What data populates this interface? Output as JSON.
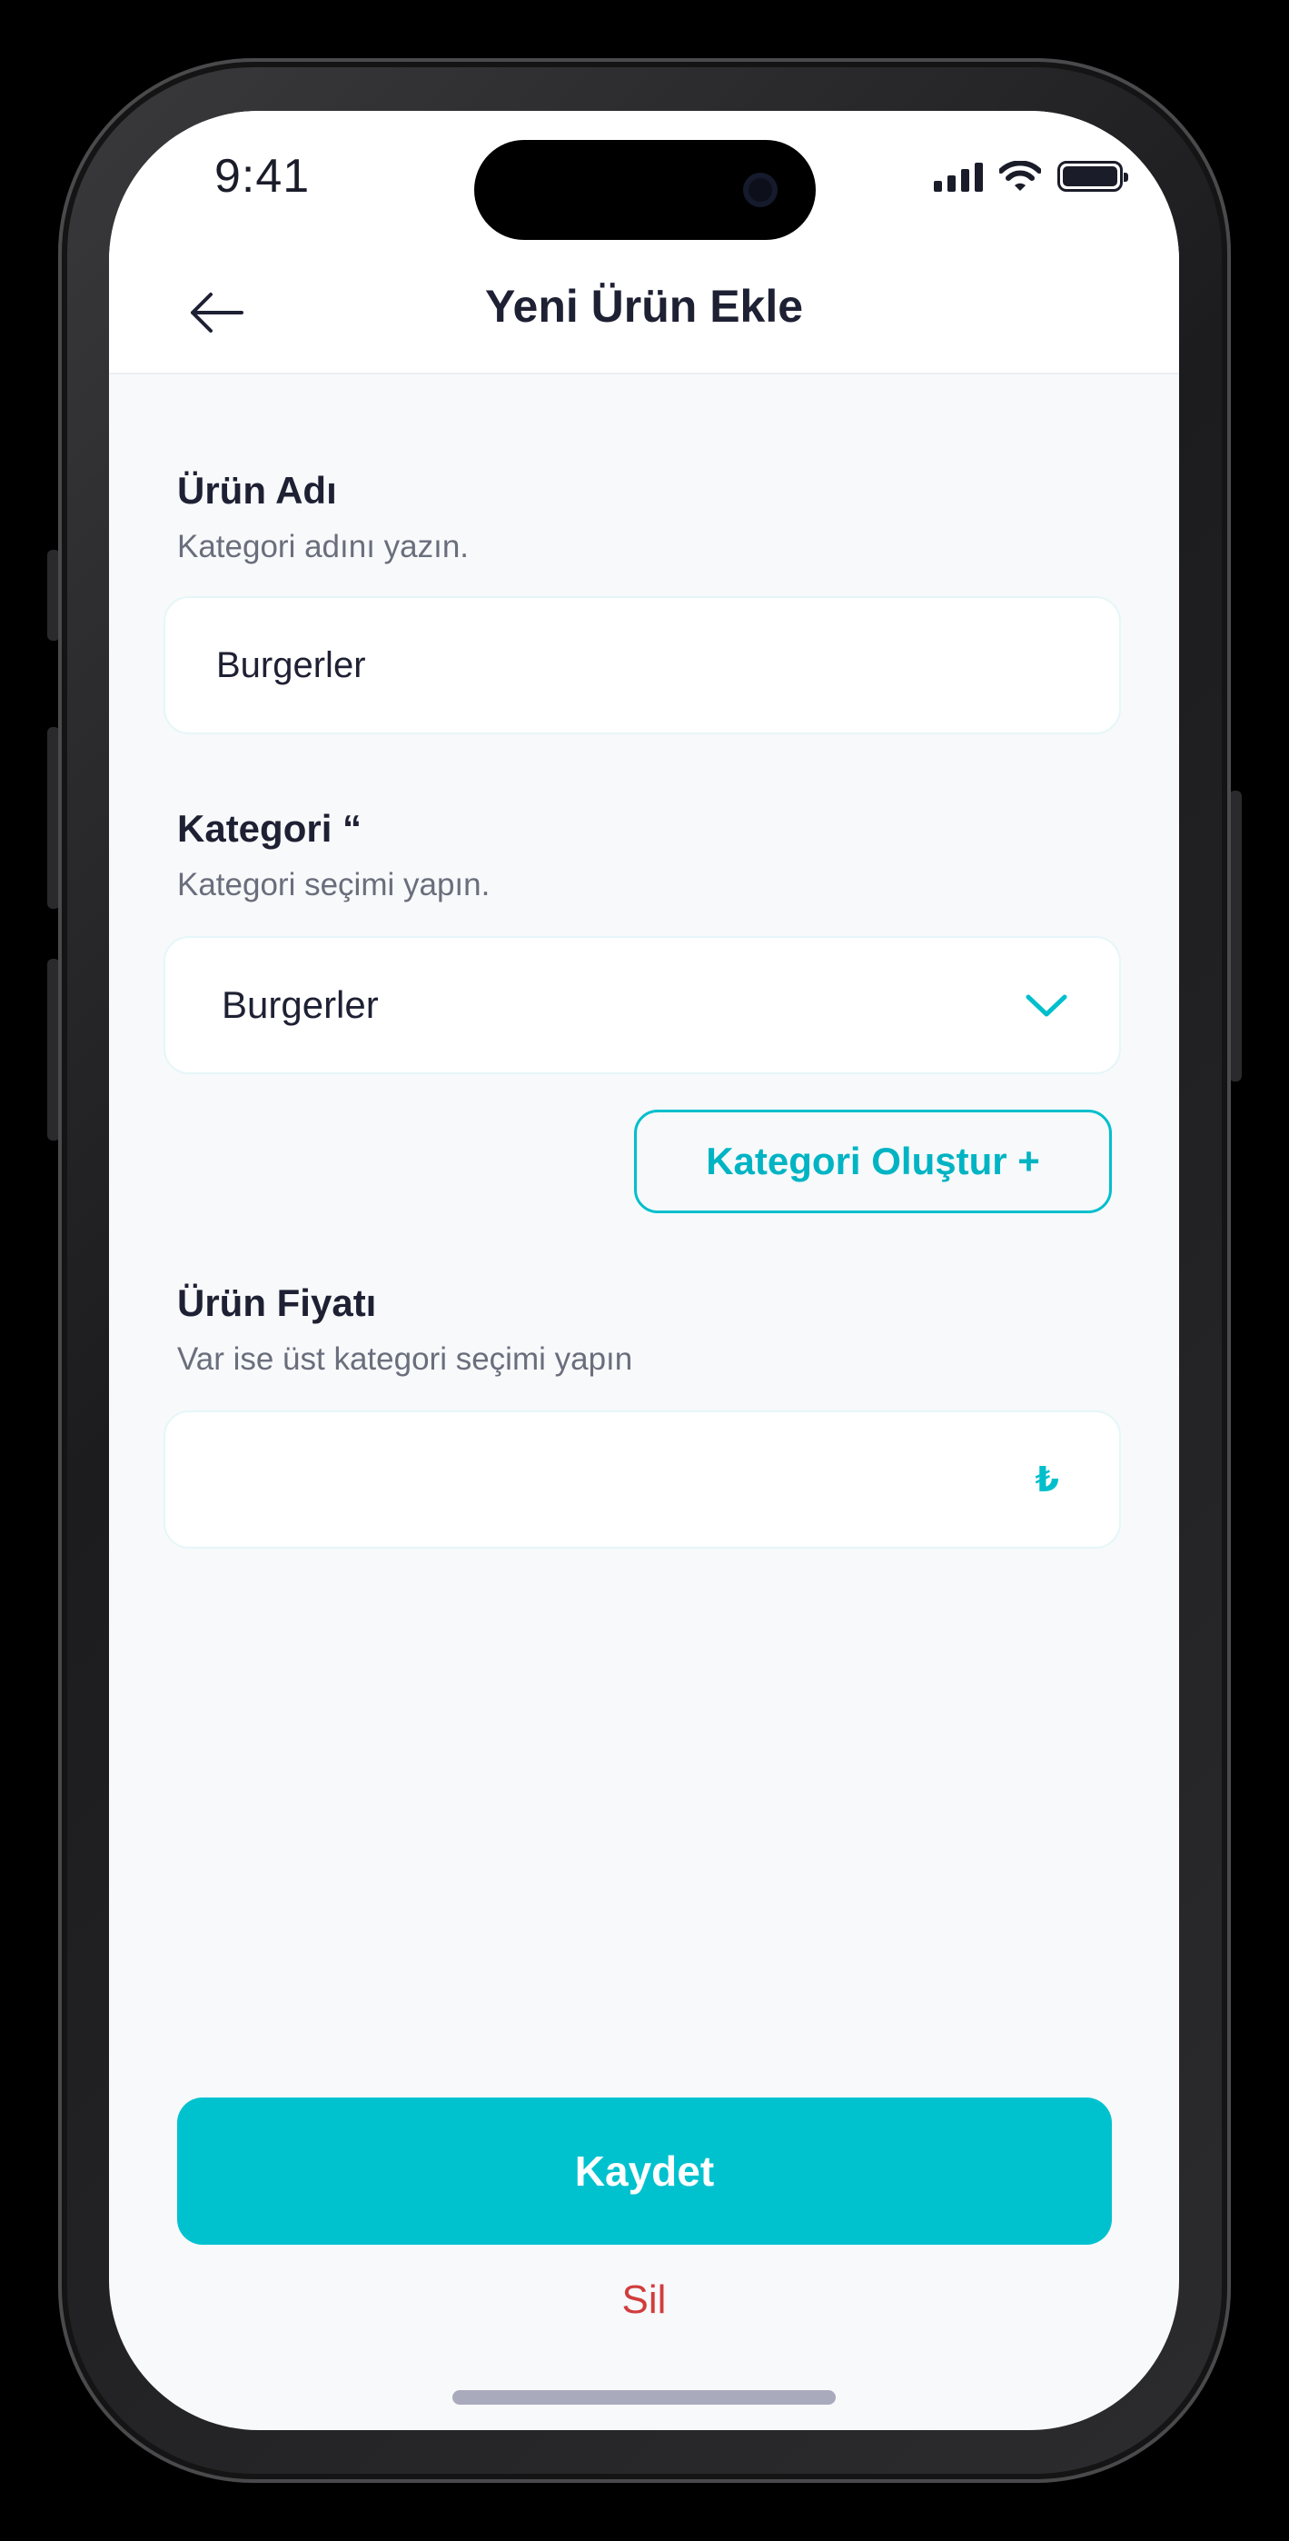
{
  "status_bar": {
    "time": "9:41"
  },
  "header": {
    "title": "Yeni Ürün Ekle"
  },
  "product_name": {
    "label": "Ürün Adı",
    "help": "Kategori adını yazın.",
    "value": "Burgerler"
  },
  "category": {
    "label": "Kategori “",
    "help": "Kategori seçimi yapın.",
    "selected": "Burgerler",
    "create_button": "Kategori Oluştur +"
  },
  "product_price": {
    "label": "Ürün Fiyatı",
    "help": "Var ise üst kategori seçimi yapın",
    "value": "",
    "currency": "₺"
  },
  "actions": {
    "save": "Kaydet",
    "delete": "Sil"
  },
  "colors": {
    "accent": "#00c2cf",
    "danger": "#d13d3d",
    "text": "#1e2033"
  }
}
